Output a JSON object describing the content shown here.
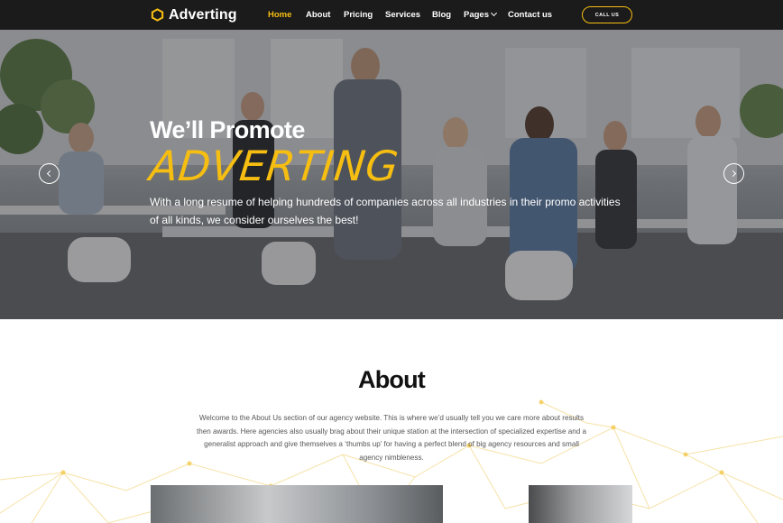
{
  "header": {
    "brand": "Adverting",
    "nav": [
      {
        "label": "Home",
        "active": true
      },
      {
        "label": "About",
        "active": false
      },
      {
        "label": "Pricing",
        "active": false
      },
      {
        "label": "Services",
        "active": false
      },
      {
        "label": "Blog",
        "active": false
      },
      {
        "label": "Pages",
        "active": false,
        "has_dropdown": true
      },
      {
        "label": "Contact us",
        "active": false
      }
    ],
    "call_button": "CALL US"
  },
  "hero": {
    "title_line1": "We’ll Promote",
    "title_line2": "ADVERTING",
    "text": "With a long resume of helping hundreds of companies across all industries in their promo activities of all kinds, we consider ourselves the best!",
    "prev_icon": "chevron-left-icon",
    "next_icon": "chevron-right-icon"
  },
  "about": {
    "title": "About",
    "text": "Welcome to the About Us section of our agency website. This is where we’d usually tell you we care more about results then awards. Here agencies also usually brag about their unique station at the intersection of specialized expertise and a generalist approach and give themselves a ‘thumbs up’ for having a perfect blend of big agency resources and small agency nimbleness."
  },
  "colors": {
    "accent": "#f7be12",
    "header_bg": "#1b1b1b",
    "text_dark": "#111111",
    "text_body": "#555555"
  }
}
